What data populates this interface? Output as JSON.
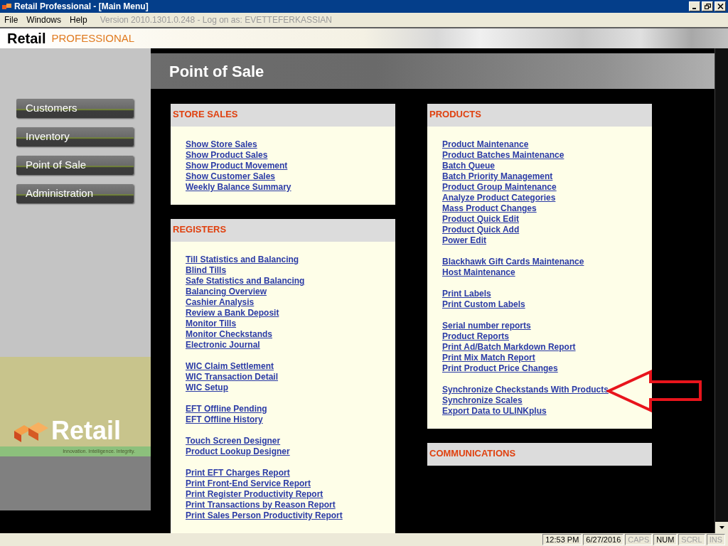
{
  "window": {
    "title": "Retail Professional - [Main Menu]"
  },
  "menu": [
    "File",
    "Windows",
    "Help"
  ],
  "version_text": "Version 2010.1301.0.248 - Log on as: EVETTEFERKASSIAN",
  "brand": {
    "name": "Retail",
    "suffix": "PROFESSIONAL"
  },
  "sidebar": {
    "items": [
      {
        "label": "Customers"
      },
      {
        "label": "Inventory"
      },
      {
        "label": "Point of Sale"
      },
      {
        "label": "Administration"
      }
    ],
    "logo": {
      "name": "Retail",
      "tagline": "Innovation. Intelligence. Integrity."
    }
  },
  "page_title": "Point of Sale",
  "columns": [
    {
      "panels": [
        {
          "title": "STORE SALES",
          "groups": [
            [
              "Show Store Sales",
              "Show Product Sales",
              "Show Product Movement",
              "Show Customer Sales",
              "Weekly Balance Summary"
            ]
          ]
        },
        {
          "title": "REGISTERS",
          "groups": [
            [
              "Till Statistics and Balancing",
              "Blind Tills",
              "Safe Statistics and Balancing",
              "Balancing Overview",
              "Cashier Analysis",
              "Review a Bank Deposit",
              "Monitor Tills",
              "Monitor Checkstands",
              "Electronic Journal"
            ],
            [
              "WIC Claim Settlement",
              "WIC Transaction Detail",
              "WIC Setup"
            ],
            [
              "EFT Offline Pending",
              "EFT Offline History"
            ],
            [
              "Touch Screen Designer",
              "Product Lookup Designer"
            ],
            [
              "Print EFT Charges Report",
              "Print Front-End Service Report",
              "Print Register Productivity Report",
              "Print Transactions by Reason Report",
              "Print Sales Person Productivity Report"
            ]
          ]
        }
      ]
    },
    {
      "panels": [
        {
          "title": "PRODUCTS",
          "groups": [
            [
              "Product Maintenance",
              "Product Batches Maintenance",
              "Batch Queue",
              "Batch Priority Management",
              "Product Group Maintenance",
              "Analyze Product Categories",
              "Mass Product Changes",
              "Product Quick Edit",
              "Product Quick Add",
              "Power Edit"
            ],
            [
              "Blackhawk Gift Cards Maintenance",
              "Host Maintenance"
            ],
            [
              "Print Labels",
              "Print Custom Labels"
            ],
            [
              "Serial number reports",
              "Product Reports",
              "Print Ad/Batch Markdown Report",
              "Print Mix Match Report",
              "Print Product Price Changes"
            ],
            [
              "Synchronize Checkstands With Products",
              "Synchronize Scales",
              "Export Data to ULINKplus"
            ]
          ]
        },
        {
          "title": "COMMUNICATIONS"
        }
      ]
    }
  ],
  "status_bar": [
    {
      "text": "12:53 PM",
      "active": true
    },
    {
      "text": "6/27/2016",
      "active": true
    },
    {
      "text": "CAPS",
      "active": false
    },
    {
      "text": "NUM",
      "active": true
    },
    {
      "text": "SCRL",
      "active": false
    },
    {
      "text": "INS",
      "active": false
    }
  ]
}
